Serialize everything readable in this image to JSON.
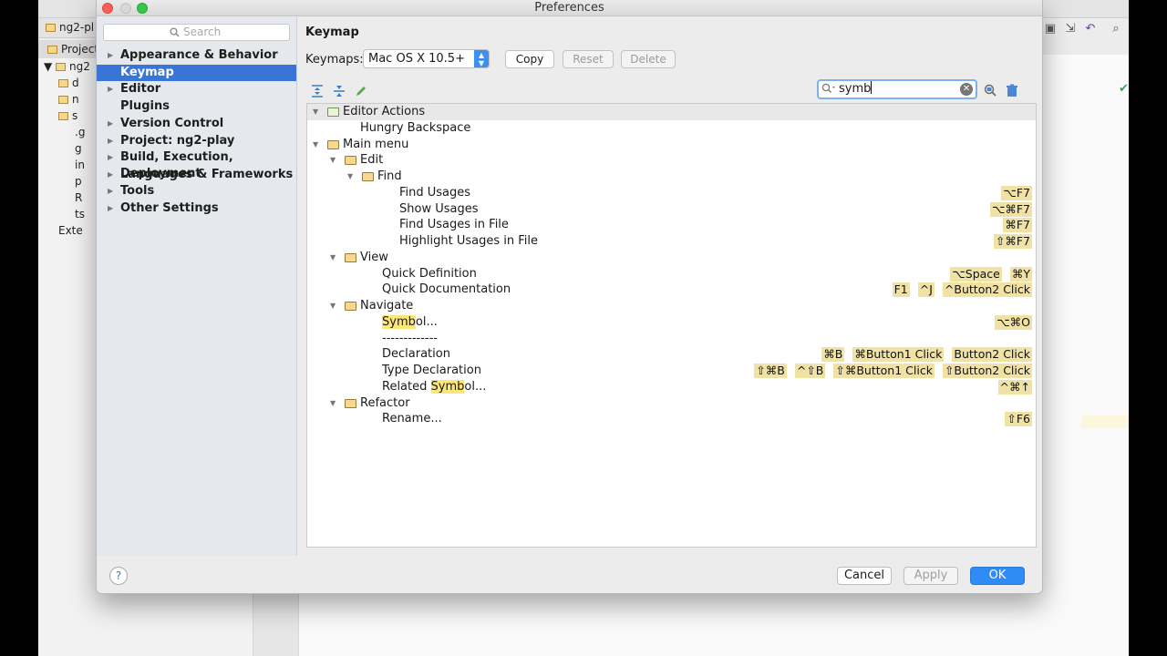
{
  "window": {
    "title": "Preferences"
  },
  "background_ide": {
    "tab_title": "ng2-pl",
    "project_tab": "Project",
    "root_label": "ng2",
    "tree_items": [
      "d",
      "n",
      "s",
      ".g",
      "g",
      "in",
      "p",
      "R",
      "ts",
      "Exte"
    ]
  },
  "sidebar": {
    "search_placeholder": "Search",
    "items": [
      {
        "label": "Appearance & Behavior",
        "arrow": "▶"
      },
      {
        "label": "Keymap",
        "arrow": ""
      },
      {
        "label": "Editor",
        "arrow": "▶"
      },
      {
        "label": "Plugins",
        "arrow": ""
      },
      {
        "label": "Version Control",
        "arrow": "▶"
      },
      {
        "label": "Project: ng2-play",
        "arrow": "▶"
      },
      {
        "label": "Build, Execution, Deployment",
        "arrow": "▶"
      },
      {
        "label": "Languages & Frameworks",
        "arrow": "▶"
      },
      {
        "label": "Tools",
        "arrow": "▶"
      },
      {
        "label": "Other Settings",
        "arrow": "▶"
      }
    ]
  },
  "main": {
    "title": "Keymap",
    "keymaps_label": "Keymaps:",
    "keymap_selected": "Mac OS X 10.5+",
    "buttons": {
      "copy": "Copy",
      "reset": "Reset",
      "delete": "Delete"
    },
    "filter_value": "symb",
    "tree": [
      {
        "label": "Editor Actions",
        "pre": "",
        "hl": "",
        "post": "",
        "type": "group",
        "expander": "▼",
        "folder": "act",
        "shortcuts": []
      },
      {
        "label": "Hungry Backspace",
        "pre": "",
        "hl": "",
        "post": "",
        "type": "action",
        "expander": "",
        "folder": "",
        "shortcuts": []
      },
      {
        "label": "Main menu",
        "pre": "",
        "hl": "",
        "post": "",
        "type": "node",
        "expander": "▼",
        "folder": "menu",
        "shortcuts": []
      },
      {
        "label": "Edit",
        "pre": "",
        "hl": "",
        "post": "",
        "type": "node",
        "expander": "▼",
        "folder": "folder",
        "shortcuts": []
      },
      {
        "label": "Find",
        "pre": "",
        "hl": "",
        "post": "",
        "type": "node",
        "expander": "▼",
        "folder": "folder",
        "shortcuts": []
      },
      {
        "label": "Find Usages",
        "pre": "",
        "hl": "",
        "post": "",
        "type": "action",
        "expander": "",
        "folder": "",
        "shortcuts": [
          "⌥F7"
        ]
      },
      {
        "label": "Show Usages",
        "pre": "",
        "hl": "",
        "post": "",
        "type": "action",
        "expander": "",
        "folder": "",
        "shortcuts": [
          "⌥⌘F7"
        ]
      },
      {
        "label": "Find Usages in File",
        "pre": "",
        "hl": "",
        "post": "",
        "type": "action",
        "expander": "",
        "folder": "",
        "shortcuts": [
          "⌘F7"
        ]
      },
      {
        "label": "Highlight Usages in File",
        "pre": "",
        "hl": "",
        "post": "",
        "type": "action",
        "expander": "",
        "folder": "",
        "shortcuts": [
          "⇧⌘F7"
        ]
      },
      {
        "label": "View",
        "pre": "",
        "hl": "",
        "post": "",
        "type": "node",
        "expander": "▼",
        "folder": "folder",
        "shortcuts": []
      },
      {
        "label": "Quick Definition",
        "pre": "",
        "hl": "",
        "post": "",
        "type": "action",
        "expander": "",
        "folder": "",
        "shortcuts": [
          "⌥Space",
          "⌘Y"
        ]
      },
      {
        "label": "Quick Documentation",
        "pre": "",
        "hl": "",
        "post": "",
        "type": "action",
        "expander": "",
        "folder": "",
        "shortcuts": [
          "F1",
          "^J",
          "^Button2 Click"
        ]
      },
      {
        "label": "Navigate",
        "pre": "",
        "hl": "",
        "post": "",
        "type": "node",
        "expander": "▼",
        "folder": "folder",
        "shortcuts": []
      },
      {
        "label": "",
        "pre": "",
        "hl": "Symb",
        "post": "ol...",
        "type": "action",
        "expander": "",
        "folder": "",
        "shortcuts": [
          "⌥⌘O"
        ]
      },
      {
        "label": "-------------",
        "pre": "",
        "hl": "",
        "post": "",
        "type": "action",
        "expander": "",
        "folder": "",
        "shortcuts": []
      },
      {
        "label": "Declaration",
        "pre": "",
        "hl": "",
        "post": "",
        "type": "action",
        "expander": "",
        "folder": "",
        "shortcuts": [
          "⌘B",
          "⌘Button1 Click",
          "Button2 Click"
        ]
      },
      {
        "label": "Type Declaration",
        "pre": "",
        "hl": "",
        "post": "",
        "type": "action",
        "expander": "",
        "folder": "",
        "shortcuts": [
          "⇧⌘B",
          "^⇧B",
          "⇧⌘Button1 Click",
          "⇧Button2 Click"
        ]
      },
      {
        "label": "",
        "pre": "Related ",
        "hl": "Symb",
        "post": "ol...",
        "type": "action",
        "expander": "",
        "folder": "",
        "shortcuts": [
          "^⌘↑"
        ]
      },
      {
        "label": "Refactor",
        "pre": "",
        "hl": "",
        "post": "",
        "type": "node",
        "expander": "▼",
        "folder": "folder",
        "shortcuts": []
      },
      {
        "label": "Rename...",
        "pre": "",
        "hl": "",
        "post": "",
        "type": "action",
        "expander": "",
        "folder": "",
        "shortcuts": [
          "⇧F6"
        ]
      }
    ]
  },
  "footer": {
    "help": "?",
    "cancel": "Cancel",
    "apply": "Apply",
    "ok": "OK"
  },
  "colors": {
    "selection": "#3875d7",
    "highlight": "#fbe67a",
    "shortcut_bg": "#f0e2a4",
    "primary_button": "#2f8bf5"
  }
}
